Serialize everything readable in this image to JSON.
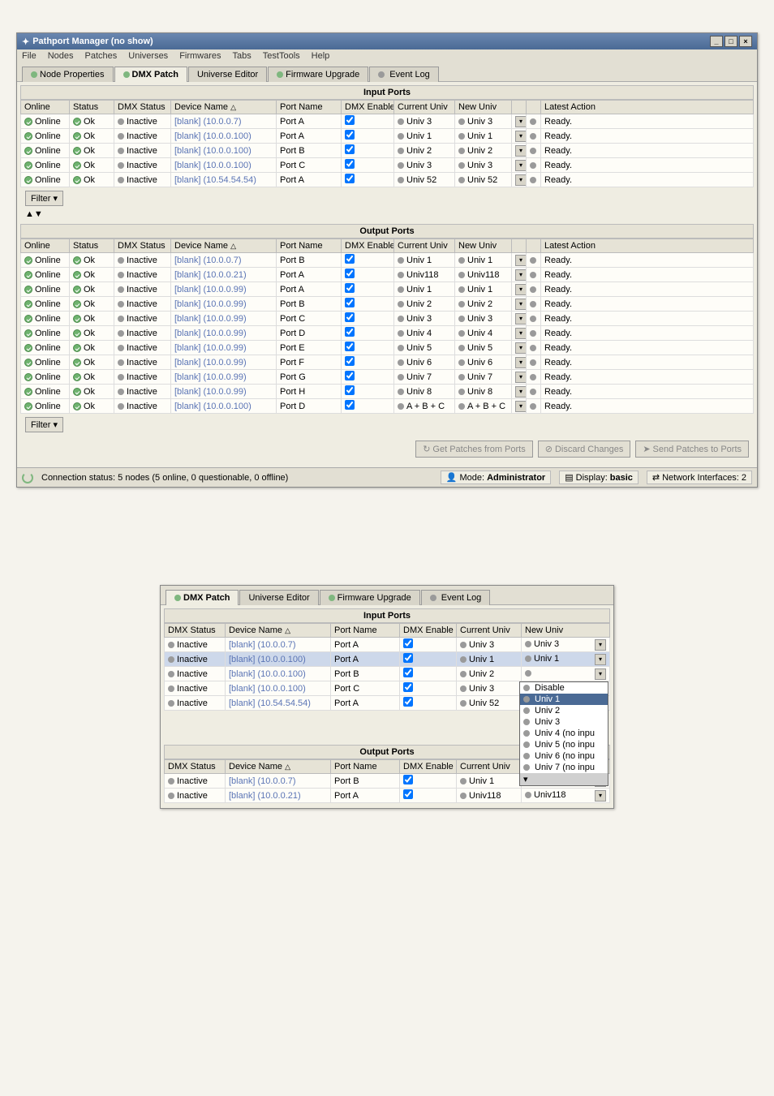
{
  "window": {
    "title": "Pathport Manager (no show)",
    "menu": [
      "File",
      "Nodes",
      "Patches",
      "Universes",
      "Firmwares",
      "Tabs",
      "TestTools",
      "Help"
    ],
    "tabs": [
      "Node Properties",
      "DMX Patch",
      "Universe Editor",
      "Firmware Upgrade",
      "Event Log"
    ],
    "selectedTab": 1,
    "inputPortsLabel": "Input Ports",
    "outputPortsLabel": "Output Ports",
    "columns": [
      "Online",
      "Status",
      "DMX Status",
      "Device Name",
      "Port Name",
      "DMX Enable",
      "Current Univ",
      "New Univ",
      "",
      "",
      "Latest Action"
    ],
    "inputRows": [
      {
        "online": "Online",
        "status": "Ok",
        "dmx": "Inactive",
        "device": "[blank] (10.0.0.7)",
        "port": "Port A",
        "enable": true,
        "cur": "Univ 3",
        "new": "Univ 3",
        "action": "Ready."
      },
      {
        "online": "Online",
        "status": "Ok",
        "dmx": "Inactive",
        "device": "[blank] (10.0.0.100)",
        "port": "Port A",
        "enable": true,
        "cur": "Univ 1",
        "new": "Univ 1",
        "action": "Ready."
      },
      {
        "online": "Online",
        "status": "Ok",
        "dmx": "Inactive",
        "device": "[blank] (10.0.0.100)",
        "port": "Port B",
        "enable": true,
        "cur": "Univ 2",
        "new": "Univ 2",
        "action": "Ready."
      },
      {
        "online": "Online",
        "status": "Ok",
        "dmx": "Inactive",
        "device": "[blank] (10.0.0.100)",
        "port": "Port C",
        "enable": true,
        "cur": "Univ 3",
        "new": "Univ 3",
        "action": "Ready."
      },
      {
        "online": "Online",
        "status": "Ok",
        "dmx": "Inactive",
        "device": "[blank] (10.54.54.54)",
        "port": "Port A",
        "enable": true,
        "cur": "Univ 52",
        "new": "Univ 52",
        "action": "Ready."
      }
    ],
    "outputRows": [
      {
        "online": "Online",
        "status": "Ok",
        "dmx": "Inactive",
        "device": "[blank] (10.0.0.7)",
        "port": "Port B",
        "enable": true,
        "cur": "Univ 1",
        "new": "Univ 1",
        "action": "Ready."
      },
      {
        "online": "Online",
        "status": "Ok",
        "dmx": "Inactive",
        "device": "[blank] (10.0.0.21)",
        "port": "Port A",
        "enable": true,
        "cur": "Univ118",
        "new": "Univ118",
        "action": "Ready."
      },
      {
        "online": "Online",
        "status": "Ok",
        "dmx": "Inactive",
        "device": "[blank] (10.0.0.99)",
        "port": "Port A",
        "enable": true,
        "cur": "Univ 1",
        "new": "Univ 1",
        "action": "Ready."
      },
      {
        "online": "Online",
        "status": "Ok",
        "dmx": "Inactive",
        "device": "[blank] (10.0.0.99)",
        "port": "Port B",
        "enable": true,
        "cur": "Univ 2",
        "new": "Univ 2",
        "action": "Ready."
      },
      {
        "online": "Online",
        "status": "Ok",
        "dmx": "Inactive",
        "device": "[blank] (10.0.0.99)",
        "port": "Port C",
        "enable": true,
        "cur": "Univ 3",
        "new": "Univ 3",
        "action": "Ready."
      },
      {
        "online": "Online",
        "status": "Ok",
        "dmx": "Inactive",
        "device": "[blank] (10.0.0.99)",
        "port": "Port D",
        "enable": true,
        "cur": "Univ 4",
        "new": "Univ 4",
        "action": "Ready."
      },
      {
        "online": "Online",
        "status": "Ok",
        "dmx": "Inactive",
        "device": "[blank] (10.0.0.99)",
        "port": "Port E",
        "enable": true,
        "cur": "Univ 5",
        "new": "Univ 5",
        "action": "Ready."
      },
      {
        "online": "Online",
        "status": "Ok",
        "dmx": "Inactive",
        "device": "[blank] (10.0.0.99)",
        "port": "Port F",
        "enable": true,
        "cur": "Univ 6",
        "new": "Univ 6",
        "action": "Ready."
      },
      {
        "online": "Online",
        "status": "Ok",
        "dmx": "Inactive",
        "device": "[blank] (10.0.0.99)",
        "port": "Port G",
        "enable": true,
        "cur": "Univ 7",
        "new": "Univ 7",
        "action": "Ready."
      },
      {
        "online": "Online",
        "status": "Ok",
        "dmx": "Inactive",
        "device": "[blank] (10.0.0.99)",
        "port": "Port H",
        "enable": true,
        "cur": "Univ 8",
        "new": "Univ 8",
        "action": "Ready."
      },
      {
        "online": "Online",
        "status": "Ok",
        "dmx": "Inactive",
        "device": "[blank] (10.0.0.100)",
        "port": "Port D",
        "enable": true,
        "cur": "A + B + C",
        "new": "A + B + C",
        "action": "Ready."
      }
    ],
    "filterLabel": "Filter",
    "btnGet": "Get Patches from Ports",
    "btnDiscard": "Discard Changes",
    "btnSend": "Send Patches to Ports",
    "connStatus": "Connection status: 5 nodes (5 online, 0 questionable, 0 offline)",
    "modeLabel": "Mode:",
    "modeVal": "Administrator",
    "displayLabel": "Display:",
    "displayVal": "basic",
    "netLabel": "Network Interfaces:",
    "netVal": "2"
  },
  "snip": {
    "tabs": [
      "DMX Patch",
      "Universe Editor",
      "Firmware Upgrade",
      "Event Log"
    ],
    "inputPortsLabel": "Input Ports",
    "outputPortsLabel": "Output Ports",
    "cols": [
      "DMX Status",
      "Device Name",
      "Port Name",
      "DMX Enable",
      "Current Univ",
      "New Univ"
    ],
    "inputRows": [
      {
        "dmx": "Inactive",
        "device": "[blank] (10.0.0.7)",
        "port": "Port A",
        "enable": true,
        "cur": "Univ 3",
        "new": "Univ 3",
        "sel": false
      },
      {
        "dmx": "Inactive",
        "device": "[blank] (10.0.0.100)",
        "port": "Port A",
        "enable": true,
        "cur": "Univ 1",
        "new": "Univ 1",
        "sel": true
      },
      {
        "dmx": "Inactive",
        "device": "[blank] (10.0.0.100)",
        "port": "Port B",
        "enable": true,
        "cur": "Univ 2",
        "new": "",
        "sel": false
      },
      {
        "dmx": "Inactive",
        "device": "[blank] (10.0.0.100)",
        "port": "Port C",
        "enable": true,
        "cur": "Univ 3",
        "new": "",
        "sel": false
      },
      {
        "dmx": "Inactive",
        "device": "[blank] (10.54.54.54)",
        "port": "Port A",
        "enable": true,
        "cur": "Univ 52",
        "new": "",
        "sel": false
      }
    ],
    "ddOptions": [
      "Disable",
      "Univ 1",
      "Univ 2",
      "Univ 3",
      "Univ 4 (no inpu",
      "Univ 5 (no inpu",
      "Univ 6 (no inpu",
      "Univ 7 (no inpu"
    ],
    "ddHighlight": 1,
    "outputRows": [
      {
        "dmx": "Inactive",
        "device": "[blank] (10.0.0.7)",
        "port": "Port B",
        "enable": true,
        "cur": "Univ 1",
        "new": "Univ 1"
      },
      {
        "dmx": "Inactive",
        "device": "[blank] (10.0.0.21)",
        "port": "Port A",
        "enable": true,
        "cur": "Univ118",
        "new": "Univ118"
      }
    ]
  }
}
